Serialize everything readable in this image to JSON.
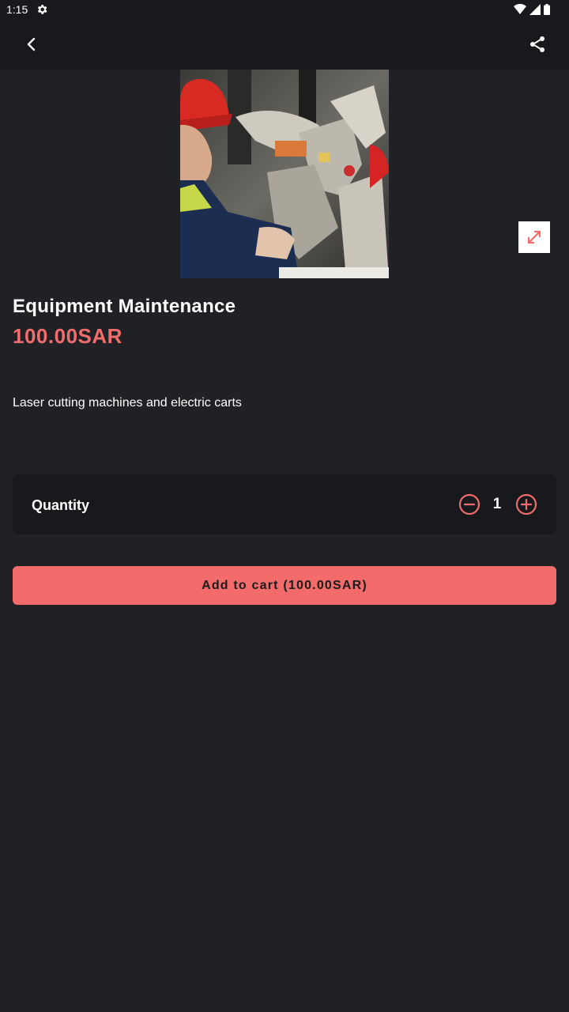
{
  "status_bar": {
    "time": "1:15"
  },
  "app_bar": {
    "back_icon": "chevron-left-icon",
    "share_icon": "share-icon"
  },
  "product": {
    "image_icon": "product-photo",
    "title": "Equipment Maintenance",
    "price": "100.00SAR",
    "description": "Laser cutting machines and electric carts"
  },
  "quantity": {
    "label": "Quantity",
    "value": "1"
  },
  "cart_button": {
    "label": "Add to cart (100.00SAR)"
  },
  "colors": {
    "background": "#202125",
    "bar": "#18191c",
    "accent": "#f36b6b"
  }
}
